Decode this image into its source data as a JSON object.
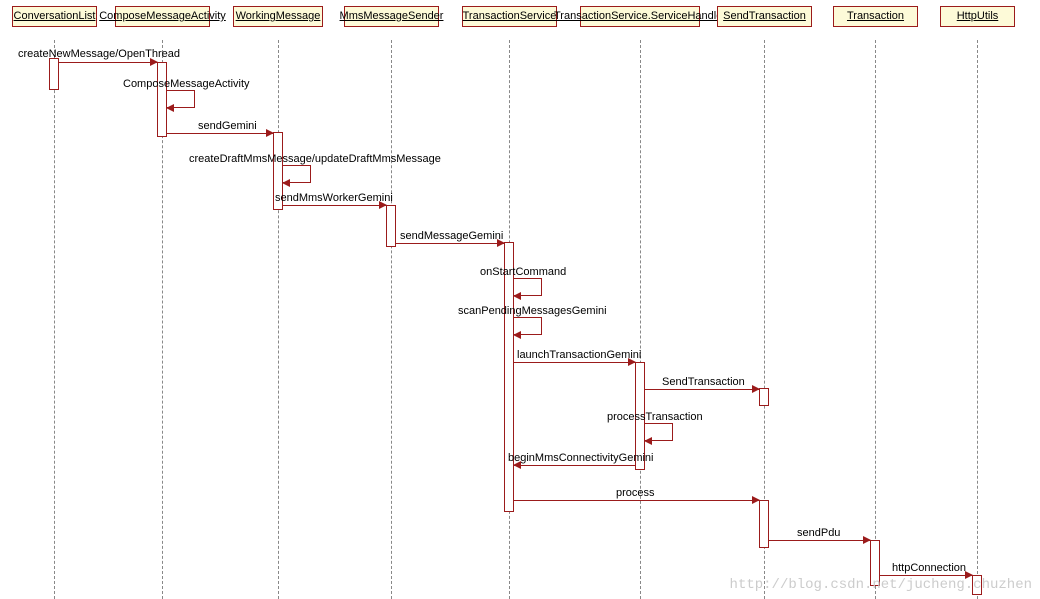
{
  "participants": {
    "p0": "ConversationList",
    "p1": "ComposeMessageActivity",
    "p2": "WorkingMessage",
    "p3": "MmsMessageSender",
    "p4": "TransactionService",
    "p5": "TransactionService.ServiceHandler",
    "p6": "SendTransaction",
    "p7": "Transaction",
    "p8": "HttpUtils"
  },
  "messages": {
    "m1": "createNewMessage/OpenThread",
    "m2": "ComposeMessageActivity",
    "m3": "sendGemini",
    "m4": "createDraftMmsMessage/updateDraftMmsMessage",
    "m5": "sendMmsWorkerGemini",
    "m6": "sendMessageGemini",
    "m7": "onStartCommand",
    "m8": "scanPendingMessagesGemini",
    "m9": "launchTransactionGemini",
    "m10": "SendTransaction",
    "m11": "processTransaction",
    "m12": "beginMmsConnectivityGemini",
    "m13": "process",
    "m14": "sendPdu",
    "m15": "httpConnection"
  },
  "watermark": "http://blog.csdn.net/jucheng.chuzhen",
  "chart_data": {
    "type": "sequence-diagram",
    "participants": [
      "ConversationList",
      "ComposeMessageActivity",
      "WorkingMessage",
      "MmsMessageSender",
      "TransactionService",
      "TransactionService.ServiceHandler",
      "SendTransaction",
      "Transaction",
      "HttpUtils"
    ],
    "messages": [
      {
        "from": "ConversationList",
        "to": "ComposeMessageActivity",
        "label": "createNewMessage/OpenThread"
      },
      {
        "from": "ComposeMessageActivity",
        "to": "ComposeMessageActivity",
        "label": "ComposeMessageActivity",
        "self": true
      },
      {
        "from": "ComposeMessageActivity",
        "to": "WorkingMessage",
        "label": "sendGemini"
      },
      {
        "from": "WorkingMessage",
        "to": "WorkingMessage",
        "label": "createDraftMmsMessage/updateDraftMmsMessage",
        "self": true
      },
      {
        "from": "WorkingMessage",
        "to": "MmsMessageSender",
        "label": "sendMmsWorkerGemini"
      },
      {
        "from": "MmsMessageSender",
        "to": "TransactionService",
        "label": "sendMessageGemini"
      },
      {
        "from": "TransactionService",
        "to": "TransactionService",
        "label": "onStartCommand",
        "self": true
      },
      {
        "from": "TransactionService",
        "to": "TransactionService",
        "label": "scanPendingMessagesGemini",
        "self": true
      },
      {
        "from": "TransactionService",
        "to": "TransactionService.ServiceHandler",
        "label": "launchTransactionGemini"
      },
      {
        "from": "TransactionService.ServiceHandler",
        "to": "SendTransaction",
        "label": "SendTransaction"
      },
      {
        "from": "TransactionService.ServiceHandler",
        "to": "TransactionService.ServiceHandler",
        "label": "processTransaction",
        "self": true
      },
      {
        "from": "TransactionService.ServiceHandler",
        "to": "TransactionService",
        "label": "beginMmsConnectivityGemini",
        "direction": "return"
      },
      {
        "from": "TransactionService",
        "to": "SendTransaction",
        "label": "process"
      },
      {
        "from": "SendTransaction",
        "to": "Transaction",
        "label": "sendPdu"
      },
      {
        "from": "Transaction",
        "to": "HttpUtils",
        "label": "httpConnection"
      }
    ]
  }
}
